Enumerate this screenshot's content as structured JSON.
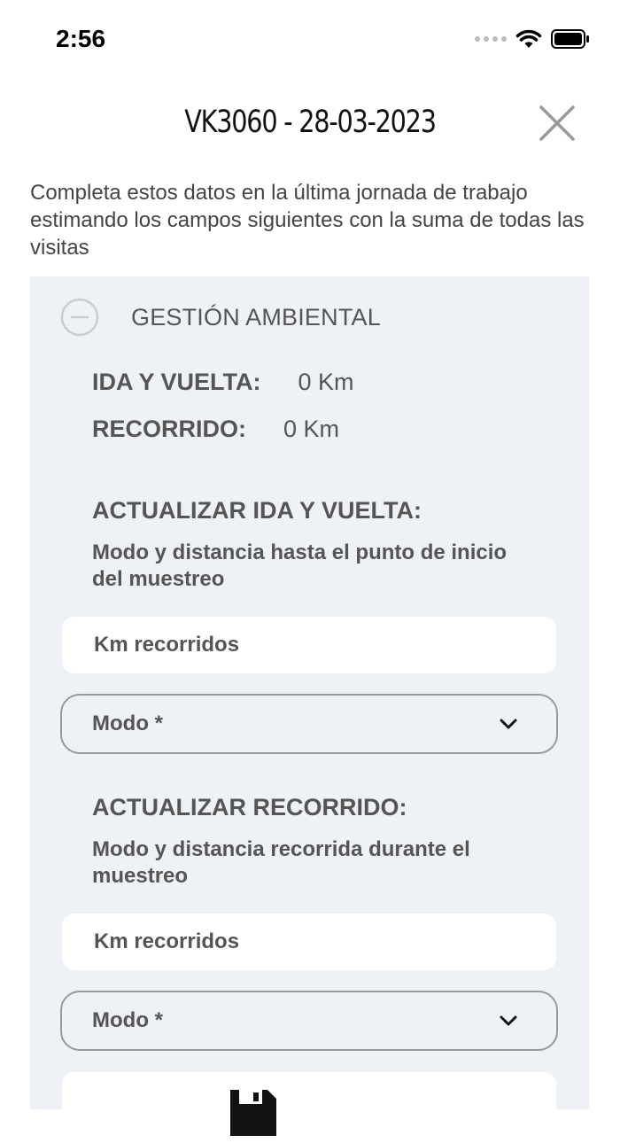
{
  "status_bar": {
    "time": "2:56"
  },
  "header": {
    "title": "VK3060 - 28-03-2023"
  },
  "intro_text": "Completa estos datos en la última jornada de trabajo estimando los campos siguientes con la suma de todas las visitas",
  "section": {
    "title": "GESTIÓN AMBIENTAL",
    "ida_vuelta": {
      "label": "IDA Y VUELTA:",
      "value": "0 Km"
    },
    "recorrido": {
      "label": "RECORRIDO:",
      "value": "0 Km"
    },
    "update_ida_vuelta": {
      "heading": "ACTUALIZAR IDA Y VUELTA:",
      "description": "Modo y distancia hasta el punto de inicio del muestreo",
      "km_placeholder": "Km recorridos",
      "mode_label": "Modo *"
    },
    "update_recorrido": {
      "heading": "ACTUALIZAR RECORRIDO:",
      "description": "Modo y distancia recorrida durante el muestreo",
      "km_placeholder": "Km recorridos",
      "mode_label": "Modo *"
    }
  },
  "icons": {
    "collapse": "minus-circle-icon",
    "close": "close-icon",
    "dropdown": "chevron-down-icon",
    "save": "floppy-disk-icon"
  }
}
